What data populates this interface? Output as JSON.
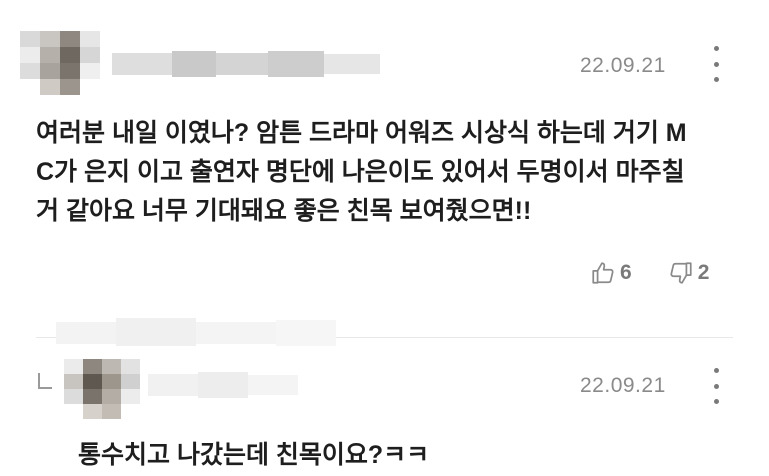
{
  "comments": [
    {
      "date": "22.09.21",
      "text_lines": [
        "여러분 내일 이였나? 암튼 드라마 어워즈 시상식 하는데 거기 M",
        "C가 은지 이고 출연자 명단에 나은이도 있어서 두명이서 마주칠",
        "거 같아요 너무 기대돼요 좋은 친목 보여줬으면!!"
      ],
      "likes": "6",
      "dislikes": "2"
    },
    {
      "date": "22.09.21",
      "text_lines": [
        "통수치고 나갔는데 친목이요?ㅋㅋ"
      ]
    }
  ],
  "icons": {
    "more": "more-vertical-icon",
    "like": "thumbs-up-icon",
    "dislike": "thumbs-down-icon",
    "reply": "reply-indicator-icon"
  },
  "colors": {
    "text": "#1e1e1e",
    "meta": "#8a8a8a",
    "divider": "#e8e8e8"
  }
}
